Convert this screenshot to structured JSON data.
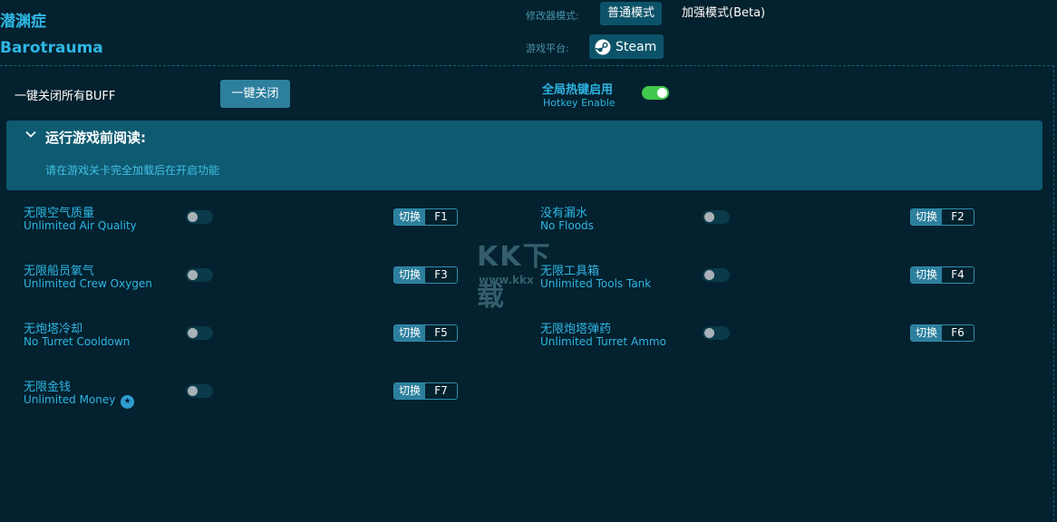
{
  "header": {
    "title_cn": "潜渊症",
    "title_en": "Barotrauma",
    "mode_label": "修改器模式:",
    "mode_normal": "普通模式",
    "mode_advanced": "加强模式(Beta)",
    "platform_label": "游戏平台:",
    "platform": "Steam",
    "platform_icon": "steam-icon"
  },
  "buff": {
    "label": "一键关闭所有BUFF",
    "close_all": "一键关闭"
  },
  "hotkey": {
    "label_cn": "全局热键启用",
    "label_en": "Hotkey Enable",
    "enabled": true,
    "color": "#3fc84b"
  },
  "notice": {
    "title": "运行游戏前阅读:",
    "body": "请在游戏关卡完全加载后在开启功能"
  },
  "cheats": [
    {
      "cn": "无限空气质量",
      "en": "Unlimited Air Quality",
      "switch": "切换",
      "key": "F1",
      "on": false,
      "star": false
    },
    {
      "cn": "没有漏水",
      "en": "No Floods",
      "switch": "切换",
      "key": "F2",
      "on": false,
      "star": false
    },
    {
      "cn": "无限船员氧气",
      "en": "Unlimited Crew Oxygen",
      "switch": "切换",
      "key": "F3",
      "on": false,
      "star": false
    },
    {
      "cn": "无限工具箱",
      "en": "Unlimited Tools Tank",
      "switch": "切换",
      "key": "F4",
      "on": false,
      "star": false
    },
    {
      "cn": "无炮塔冷却",
      "en": "No Turret Cooldown",
      "switch": "切换",
      "key": "F5",
      "on": false,
      "star": false
    },
    {
      "cn": "无限炮塔弹药",
      "en": "Unlimited Turret Ammo",
      "switch": "切换",
      "key": "F6",
      "on": false,
      "star": false
    },
    {
      "cn": "无限金钱",
      "en": "Unlimited Money",
      "switch": "切换",
      "key": "F7",
      "on": false,
      "star": true
    }
  ],
  "watermark": {
    "logo": "KK下载",
    "url": "www.kkx"
  },
  "colors": {
    "background": "#03212e",
    "accent": "#2fb6e4",
    "panel": "#0e5a71",
    "button": "#2c7f9d"
  }
}
